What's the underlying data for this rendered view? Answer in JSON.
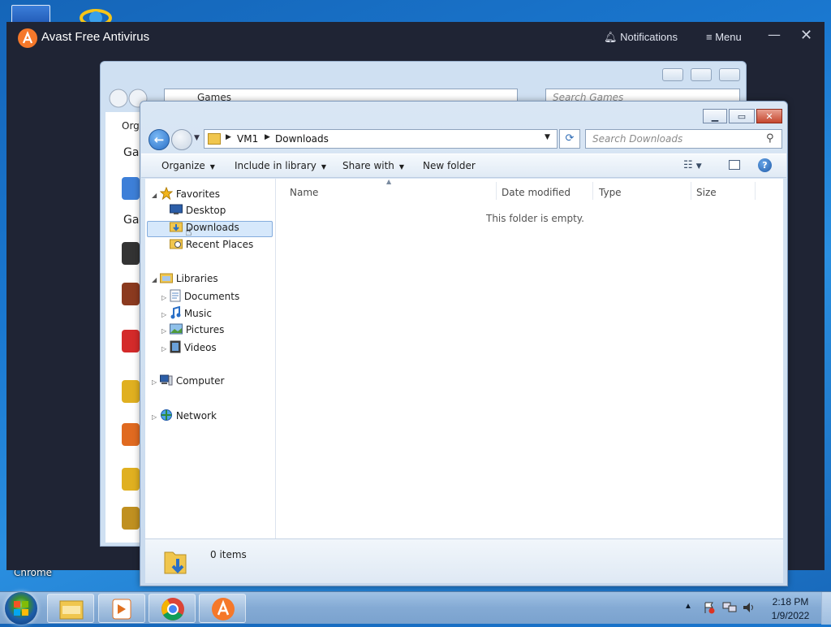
{
  "avast": {
    "title": "Avast Free Antivirus",
    "notifications_label": "Notifications",
    "menu_label": "Menu",
    "minimize_glyph": "—",
    "close_glyph": "✕"
  },
  "desktop": {
    "chrome_label": "Chrome"
  },
  "back_window": {
    "address_text": "Games",
    "search_placeholder": "Search Games",
    "organize_label": "Orga",
    "group_labels": [
      "Gar",
      "Gar"
    ]
  },
  "window": {
    "address": {
      "root": "VM1",
      "current": "Downloads"
    },
    "search_placeholder": "Search Downloads",
    "toolbar": {
      "organize": "Organize",
      "include_in_library": "Include in library",
      "share_with": "Share with",
      "new_folder": "New folder"
    },
    "nav": {
      "favorites": "Favorites",
      "desktop": "Desktop",
      "downloads": "Downloads",
      "recent_places": "Recent Places",
      "libraries": "Libraries",
      "documents": "Documents",
      "music": "Music",
      "pictures": "Pictures",
      "videos": "Videos",
      "computer": "Computer",
      "network": "Network"
    },
    "columns": {
      "name": "Name",
      "date_modified": "Date modified",
      "type": "Type",
      "size": "Size"
    },
    "empty_message": "This folder is empty.",
    "status": {
      "item_count": "0 items"
    }
  },
  "taskbar": {
    "time": "2:18 PM",
    "date": "1/9/2022",
    "tray_up_glyph": "▲"
  },
  "colors": {
    "avast_bg": "#1f2434",
    "avast_accent": "#f5782a",
    "selection": "#d6e8fb",
    "taskbar": "#84aad4"
  },
  "icons": [
    "windows-logo-icon",
    "explorer-icon",
    "media-player-icon",
    "chrome-icon",
    "avast-icon",
    "star-icon",
    "desktop-icon",
    "folder-icon",
    "library-icon",
    "documents-icon",
    "music-icon",
    "pictures-icon",
    "videos-icon",
    "computer-icon",
    "network-icon",
    "search-icon",
    "refresh-icon",
    "help-icon",
    "view-icon",
    "preview-pane-icon",
    "bell-icon",
    "hamburger-icon"
  ]
}
